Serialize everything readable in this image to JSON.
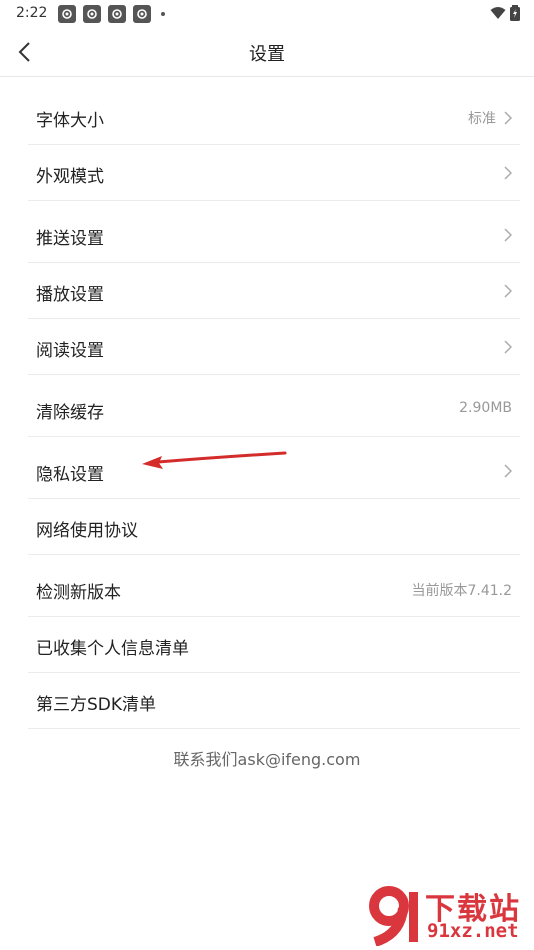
{
  "status_bar": {
    "time": "2:22",
    "notification_icons": [
      "app-notification-icon",
      "app-notification-icon",
      "app-notification-icon",
      "app-notification-icon"
    ]
  },
  "header": {
    "title": "设置",
    "back_icon": "chevron-left-icon"
  },
  "settings": {
    "items": [
      {
        "label": "字体大小",
        "value": "标准",
        "chevron": true
      },
      {
        "label": "外观模式",
        "value": "",
        "chevron": true
      },
      {
        "label": "推送设置",
        "value": "",
        "chevron": true
      },
      {
        "label": "播放设置",
        "value": "",
        "chevron": true
      },
      {
        "label": "阅读设置",
        "value": "",
        "chevron": true
      },
      {
        "label": "清除缓存",
        "value": "2.90MB",
        "chevron": false
      },
      {
        "label": "隐私设置",
        "value": "",
        "chevron": true
      },
      {
        "label": "网络使用协议",
        "value": "",
        "chevron": false
      },
      {
        "label": "检测新版本",
        "value": "当前版本7.41.2",
        "chevron": false
      },
      {
        "label": "已收集个人信息清单",
        "value": "",
        "chevron": false
      },
      {
        "label": "第三方SDK清单",
        "value": "",
        "chevron": false
      }
    ]
  },
  "contact": "联系我们ask@ifeng.com",
  "watermark": {
    "text": "下载站",
    "url": "91xz.net"
  },
  "colors": {
    "accent_red": "#d9363e",
    "annotation_arrow": "#d42b2b"
  }
}
